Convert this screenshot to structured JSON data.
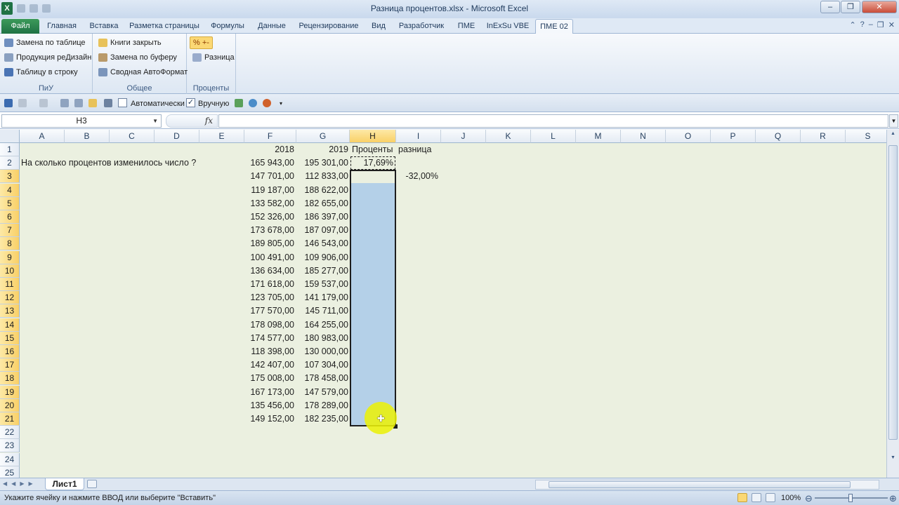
{
  "window": {
    "title": "Разница процентов.xlsx - Microsoft Excel"
  },
  "tabs": [
    {
      "label": "Файл"
    },
    {
      "label": "Главная"
    },
    {
      "label": "Вставка"
    },
    {
      "label": "Разметка страницы"
    },
    {
      "label": "Формулы"
    },
    {
      "label": "Данные"
    },
    {
      "label": "Рецензирование"
    },
    {
      "label": "Вид"
    },
    {
      "label": "Разработчик"
    },
    {
      "label": "ПМЕ"
    },
    {
      "label": "InExSu VBE"
    },
    {
      "label": "ПМЕ 02"
    }
  ],
  "ribbon": {
    "groups": [
      {
        "title": "ПиУ",
        "buttons": [
          "Замена по таблице",
          "Продукция реДизайн",
          "Таблицу в строку"
        ]
      },
      {
        "title": "Общее",
        "buttons": [
          "Книги закрыть",
          "Замена по буферу",
          "Сводная АвтоФормат"
        ]
      },
      {
        "title": "Проценты",
        "buttons": [
          "% +-",
          "Разница"
        ]
      }
    ]
  },
  "qat2": {
    "auto_label": "Автоматически",
    "auto_checked": false,
    "manual_label": "Вручную",
    "manual_checked": true
  },
  "formula_bar": {
    "name_box": "H3",
    "fx": "fx",
    "formula": ""
  },
  "columns": [
    "A",
    "B",
    "C",
    "D",
    "E",
    "F",
    "G",
    "H",
    "I",
    "J",
    "K",
    "L",
    "M",
    "N",
    "O",
    "P",
    "Q",
    "R",
    "S"
  ],
  "selected_column": "H",
  "rows": [
    "1",
    "2",
    "3",
    "4",
    "5",
    "6",
    "7",
    "8",
    "9",
    "10",
    "11",
    "12",
    "13",
    "14",
    "15",
    "16",
    "17",
    "18",
    "19",
    "20",
    "21",
    "22",
    "23",
    "24",
    "25"
  ],
  "cells": {
    "A2": "На сколько процентов изменилось число ?",
    "F1": "2018",
    "G1": "2019",
    "H1": "Проценты",
    "I1": "разница",
    "H2": "17,69%",
    "I3": "-32,00%",
    "F": [
      "165 943,00",
      "147 701,00",
      "119 187,00",
      "133 582,00",
      "152 326,00",
      "173 678,00",
      "189 805,00",
      "100 491,00",
      "136 634,00",
      "171 618,00",
      "123 705,00",
      "177 570,00",
      "178 098,00",
      "174 577,00",
      "118 398,00",
      "142 407,00",
      "175 008,00",
      "167 173,00",
      "135 456,00",
      "149 152,00"
    ],
    "G": [
      "195 301,00",
      "112 833,00",
      "188 622,00",
      "182 655,00",
      "186 397,00",
      "187 097,00",
      "146 543,00",
      "109 906,00",
      "185 277,00",
      "159 537,00",
      "141 179,00",
      "145 711,00",
      "164 255,00",
      "180 983,00",
      "130 000,00",
      "107 304,00",
      "178 458,00",
      "147 579,00",
      "178 289,00",
      "182 235,00"
    ]
  },
  "sheets": [
    {
      "name": "Лист1"
    }
  ],
  "status": {
    "message": "Укажите ячейку и нажмите ВВОД или выберите \"Вставить\"",
    "zoom": "100%"
  }
}
